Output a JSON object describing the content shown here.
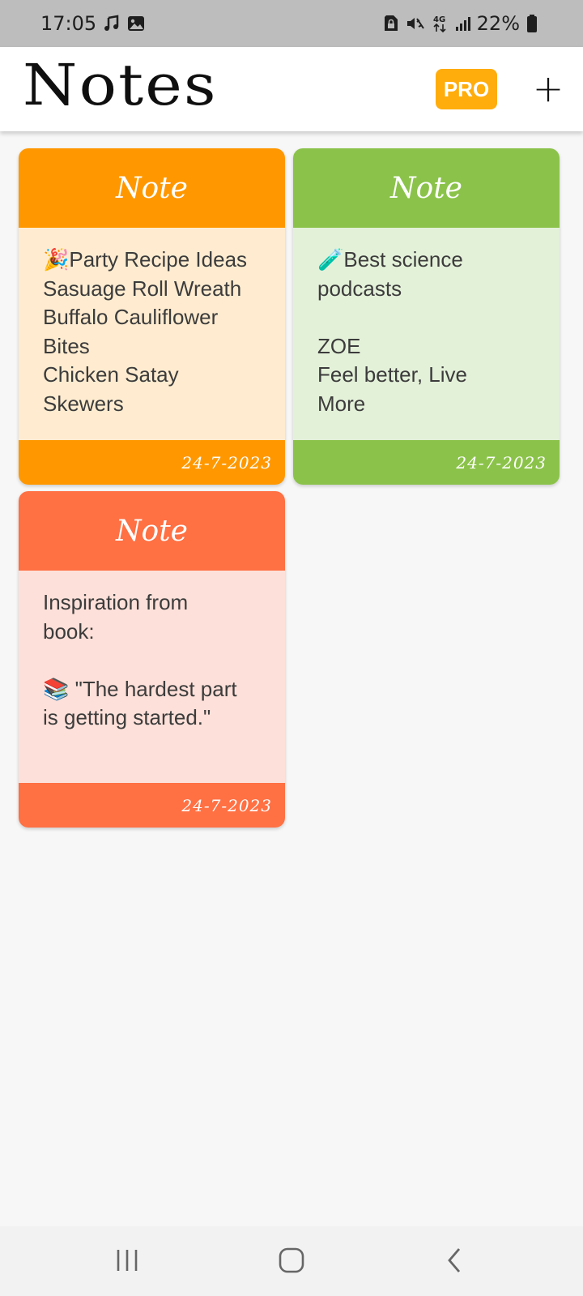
{
  "status_bar": {
    "time": "17:05",
    "left_icons": [
      "music-note-icon",
      "image-icon"
    ],
    "right_icons": [
      "sim-lock-icon",
      "mute-vibrate-icon",
      "4g-data-icon",
      "signal-icon",
      "battery-icon"
    ],
    "network": "4G",
    "battery": "22%"
  },
  "app_bar": {
    "title": "Notes",
    "pro_label": "PRO",
    "add_label": "+"
  },
  "notes": [
    {
      "header": "Note",
      "body": "🎉Party Recipe Ideas\nSasuage Roll Wreath\nBuffalo Cauliflower\nBites\nChicken Satay\nSkewers",
      "date": "24-7-2023",
      "header_color": "#ff9800",
      "body_color": "#ffecd0"
    },
    {
      "header": "Note",
      "body": "🧪Best science\npodcasts\n\nZOE\nFeel better, Live\nMore",
      "date": "24-7-2023",
      "header_color": "#8bc34a",
      "body_color": "#e4f1d9"
    },
    {
      "header": "Note",
      "body": "Inspiration from\nbook:\n\n📚 \"The hardest part\nis getting started.\"",
      "date": "24-7-2023",
      "header_color": "#ff7043",
      "body_color": "#fde0d9"
    }
  ],
  "nav_bar": {
    "icons": [
      "recents-icon",
      "home-icon",
      "back-icon"
    ]
  }
}
